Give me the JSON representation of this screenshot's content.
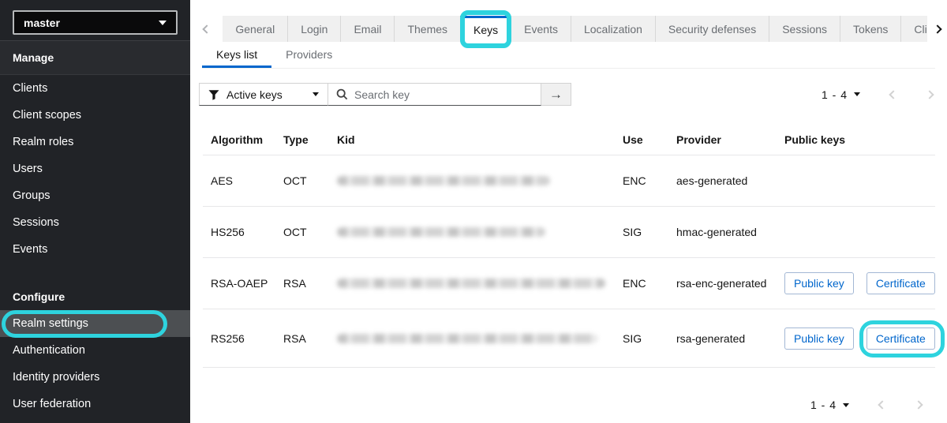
{
  "sidebar": {
    "realm_selector": {
      "value": "master"
    },
    "sections": [
      {
        "label": "Manage",
        "items": [
          "Clients",
          "Client scopes",
          "Realm roles",
          "Users",
          "Groups",
          "Sessions",
          "Events"
        ]
      },
      {
        "label": "Configure",
        "items": [
          "Realm settings",
          "Authentication",
          "Identity providers",
          "User federation"
        ],
        "selected_item": "Realm settings"
      }
    ]
  },
  "tabs": {
    "items": [
      "General",
      "Login",
      "Email",
      "Themes",
      "Keys",
      "Events",
      "Localization",
      "Security defenses",
      "Sessions",
      "Tokens",
      "Cli"
    ],
    "active": "Keys"
  },
  "subtabs": {
    "items": [
      "Keys list",
      "Providers"
    ],
    "active": "Keys list"
  },
  "toolbar": {
    "filter": {
      "selected": "Active keys"
    },
    "search": {
      "placeholder": "Search key"
    },
    "arrow_button": "→"
  },
  "pagination": {
    "range_label": "1 - 4"
  },
  "table": {
    "columns": [
      "Algorithm",
      "Type",
      "Kid",
      "Use",
      "Provider",
      "Public keys"
    ],
    "rows": [
      {
        "algorithm": "AES",
        "type": "OCT",
        "kid_redacted": true,
        "use": "ENC",
        "provider": "aes-generated",
        "buttons": []
      },
      {
        "algorithm": "HS256",
        "type": "OCT",
        "kid_redacted": true,
        "use": "SIG",
        "provider": "hmac-generated",
        "buttons": []
      },
      {
        "algorithm": "RSA-OAEP",
        "type": "RSA",
        "kid_redacted": true,
        "use": "ENC",
        "provider": "rsa-enc-generated",
        "buttons": [
          "Public key",
          "Certificate"
        ]
      },
      {
        "algorithm": "RS256",
        "type": "RSA",
        "kid_redacted": true,
        "use": "SIG",
        "provider": "rsa-generated",
        "buttons": [
          "Public key",
          "Certificate"
        ],
        "highlighted_button": "Certificate"
      }
    ]
  },
  "icons": {
    "filter": "funnel-icon",
    "search": "magnifier-icon",
    "caret": "caret-down-icon",
    "chevron_left": "chevron-left-icon",
    "chevron_right": "chevron-right-icon"
  },
  "colors": {
    "accent_blue": "#0066cc",
    "annotation_cyan": "#2ed3de",
    "sidebar_bg": "#212327",
    "tab_strip_bg": "#f0f0f0"
  }
}
